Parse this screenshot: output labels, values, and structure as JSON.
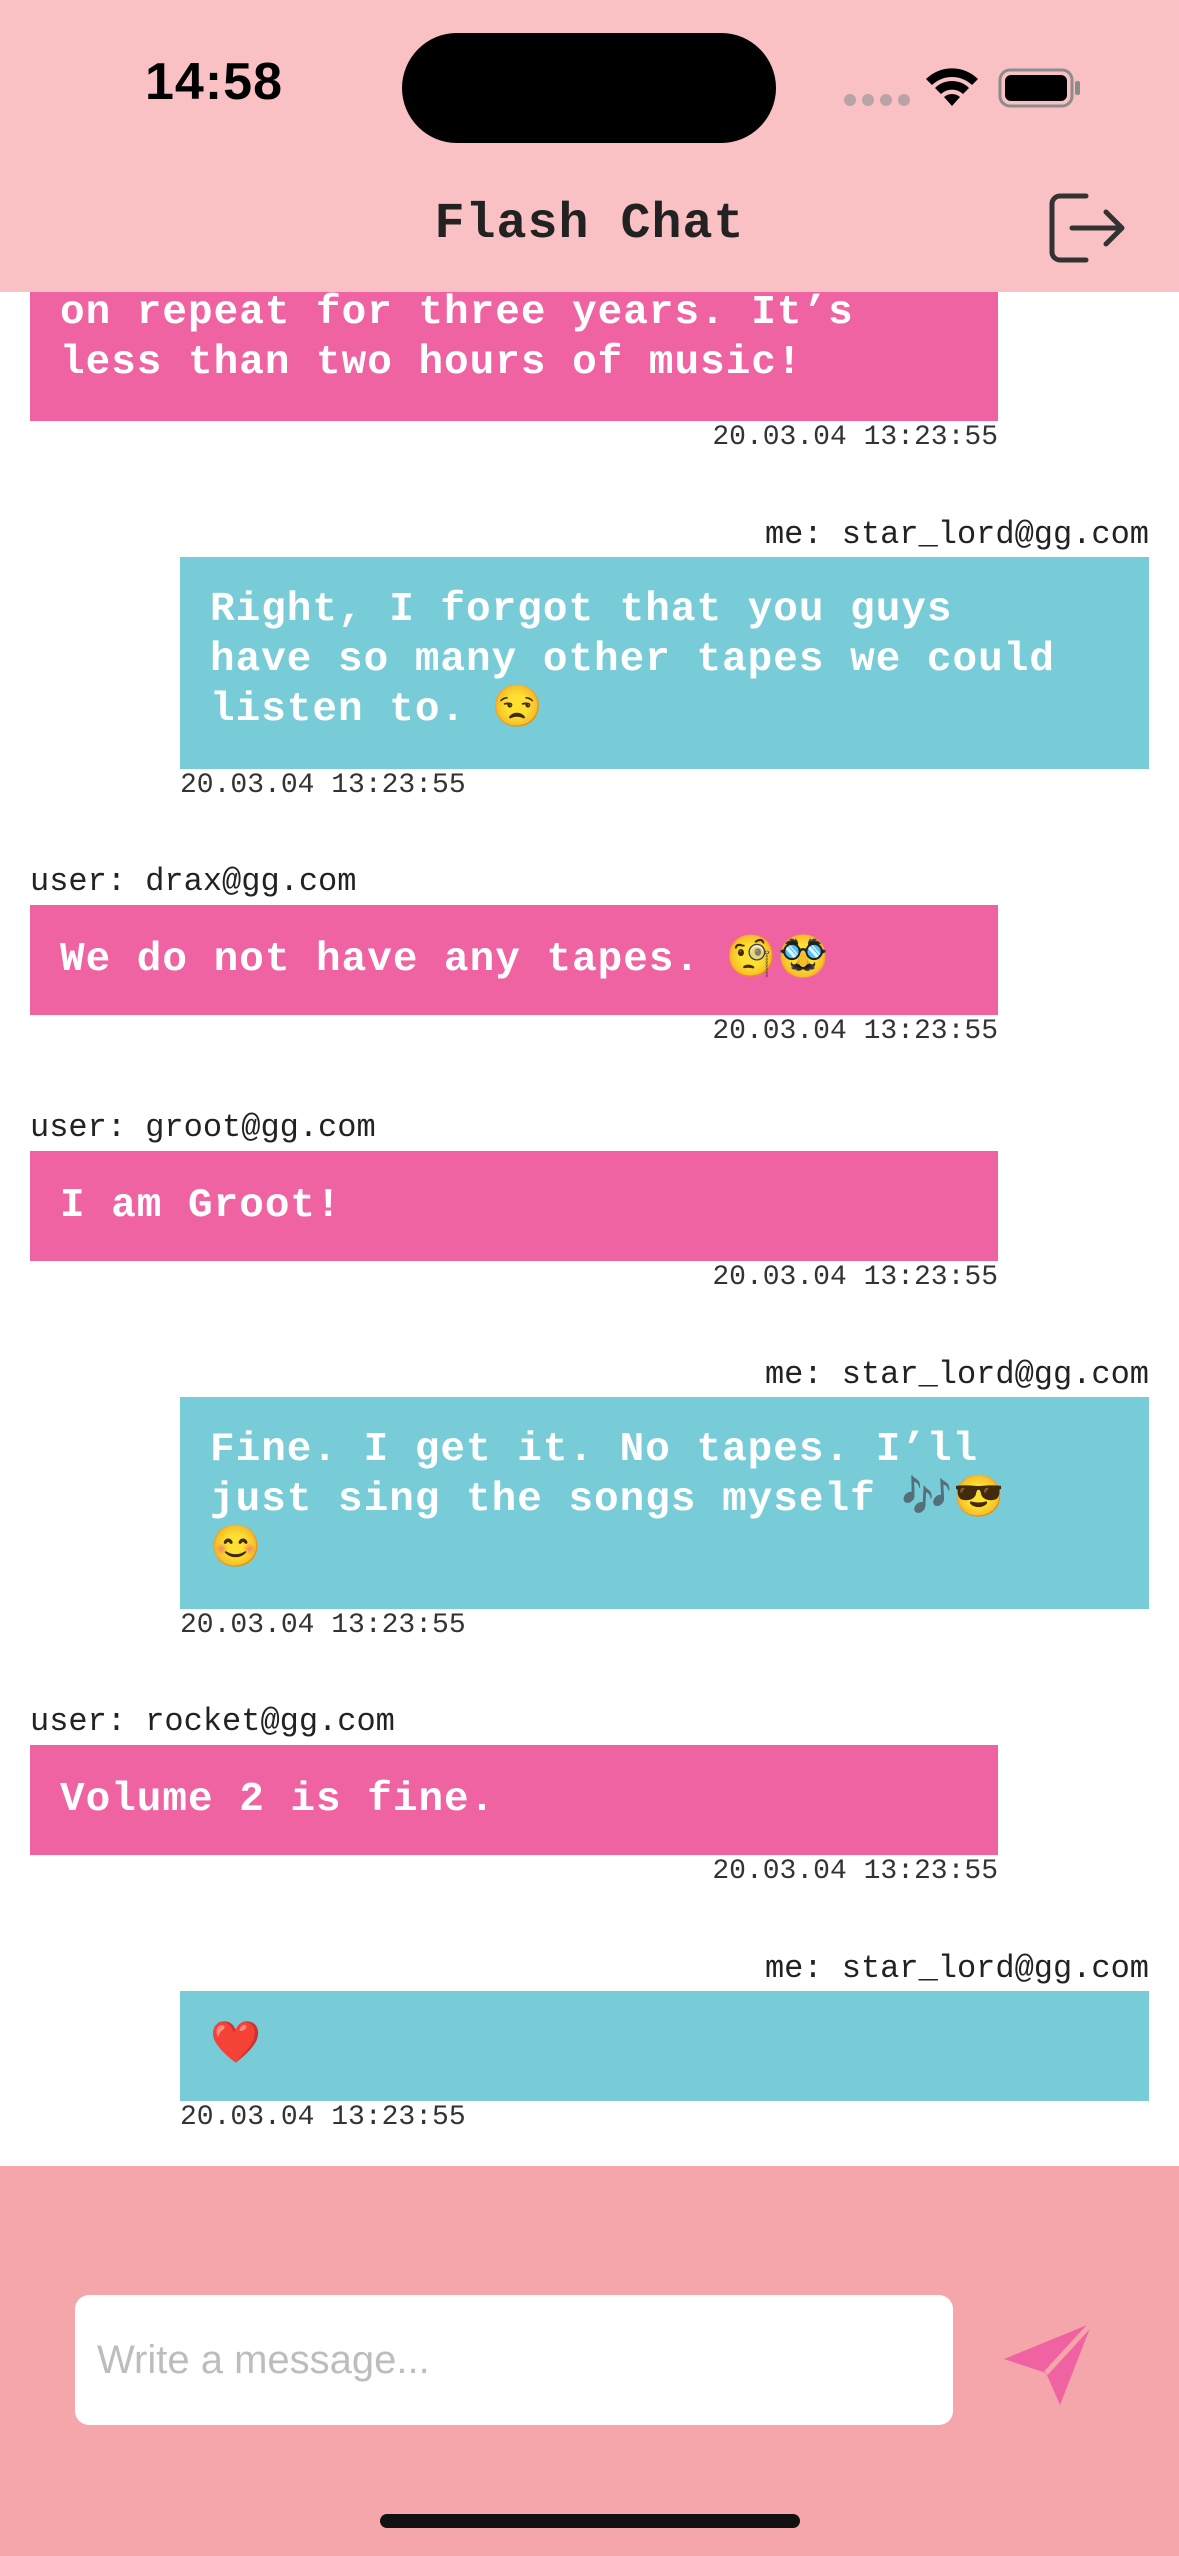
{
  "status_bar": {
    "time": "14:58"
  },
  "header": {
    "title": "Flash Chat",
    "logout_icon": "logout-icon"
  },
  "messages": [
    {
      "from": "other",
      "text_lines": [
        "on repeat for three years. It’s",
        "less than two hours of music!"
      ],
      "timestamp": "20.03.04 13:23:55"
    },
    {
      "from": "me",
      "sender": "me: star_lord@gg.com",
      "text_lines": [
        "Right, I forgot that you guys",
        "have so many other tapes we could",
        "listen to. 😒"
      ],
      "timestamp": "20.03.04 13:23:55"
    },
    {
      "from": "other",
      "sender": "user: drax@gg.com",
      "text_lines": [
        "We do not have any tapes. 🧐🥸"
      ],
      "timestamp": "20.03.04 13:23:55"
    },
    {
      "from": "other",
      "sender": "user: groot@gg.com",
      "text_lines": [
        "I am Groot!"
      ],
      "timestamp": "20.03.04 13:23:55"
    },
    {
      "from": "me",
      "sender": "me: star_lord@gg.com",
      "text_lines": [
        "Fine. I get it. No tapes. I’ll",
        "just sing the songs myself 🎶😎",
        "😊"
      ],
      "timestamp": "20.03.04 13:23:55"
    },
    {
      "from": "other",
      "sender": "user: rocket@gg.com",
      "text_lines": [
        "Volume 2 is fine."
      ],
      "timestamp": "20.03.04 13:23:55"
    },
    {
      "from": "me",
      "sender": "me: star_lord@gg.com",
      "text_lines": [
        "❤️"
      ],
      "timestamp": "20.03.04 13:23:55"
    }
  ],
  "composer": {
    "placeholder": "Write a message...",
    "value": "",
    "send_icon": "send-icon"
  },
  "colors": {
    "header_bg": "#f9c1c4",
    "composer_bg": "#f5a6ab",
    "other_bubble": "#ef63a2",
    "me_bubble": "#77ccd7",
    "send_icon": "#ef63a2"
  }
}
